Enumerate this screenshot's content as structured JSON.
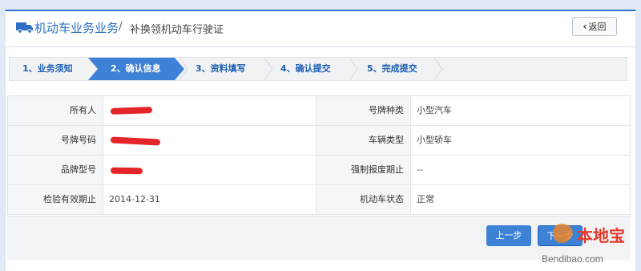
{
  "header": {
    "title_main": "机动车业务业务",
    "separator": "/",
    "title_sub": "补换领机动车行驶证",
    "back_label": "返回"
  },
  "steps": [
    {
      "label": "1、业务须知",
      "active": false
    },
    {
      "label": "2、确认信息",
      "active": true
    },
    {
      "label": "3、资料填写",
      "active": false
    },
    {
      "label": "4、确认提交",
      "active": false
    },
    {
      "label": "5、完成提交",
      "active": false
    }
  ],
  "table": {
    "rows": [
      {
        "left_label": "所有人",
        "left_value": "",
        "right_label": "号牌种类",
        "right_value": "小型汽车"
      },
      {
        "left_label": "号牌号码",
        "left_value": "",
        "right_label": "车辆类型",
        "right_value": "小型轿车"
      },
      {
        "left_label": "品牌型号",
        "left_value": "",
        "right_label": "强制报废期止",
        "right_value": "--"
      },
      {
        "left_label": "检验有效期止",
        "left_value": "2014-12-31",
        "right_label": "机动车状态",
        "right_value": "正常"
      }
    ]
  },
  "buttons": {
    "prev_label": "上一步",
    "next_label": "下一步"
  },
  "watermark": {
    "logo_text": "本地宝",
    "site_text": "Bendibao.com"
  },
  "colors": {
    "accent": "#3d82d6",
    "title": "#2b6fc4",
    "redaction": "#e5242a",
    "page_bg": "#dfe9f7"
  }
}
